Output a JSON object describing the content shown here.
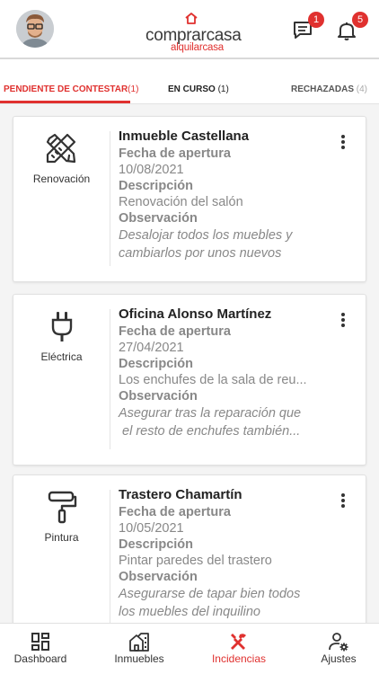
{
  "header": {
    "logo_main": "comprarcasa",
    "logo_sub": "alquilarcasa",
    "messages_count": "1",
    "notifications_count": "5"
  },
  "tabs": [
    {
      "label": "PENDIENTE DE CONTESTAR",
      "count": "(1)"
    },
    {
      "label": "EN CURSO",
      "count": "(1)"
    },
    {
      "label": "RECHAZADAS",
      "count": "(4)"
    }
  ],
  "labels": {
    "fecha": "Fecha de apertura",
    "descripcion": "Descripción",
    "observacion": "Observación"
  },
  "cards": [
    {
      "category": "Renovación",
      "icon": "renovation-icon",
      "title": "Inmueble Castellana",
      "fecha": "10/08/2021",
      "descripcion": "Renovación del salón",
      "obs_line1": "Desalojar todos los muebles y",
      "obs_line2": "cambiarlos por unos nuevos"
    },
    {
      "category": "Eléctrica",
      "icon": "plug-icon",
      "title": "Oficina Alonso Martínez",
      "fecha": "27/04/2021",
      "descripcion": "Los enchufes de la sala de reu...",
      "obs_line1": "Asegurar tras la reparación que",
      "obs_line2": " el resto de enchufes también..."
    },
    {
      "category": "Pintura",
      "icon": "paint-roller-icon",
      "title": "Trastero Chamartín",
      "fecha": "10/05/2021",
      "descripcion": "Pintar paredes del trastero",
      "obs_line1": "Asegurarse de tapar bien todos",
      "obs_line2": "los muebles del inquilino"
    }
  ],
  "bottom_nav": [
    {
      "label": "Dashboard",
      "icon": "dashboard-icon"
    },
    {
      "label": "Inmuebles",
      "icon": "buildings-icon"
    },
    {
      "label": "Incidencias",
      "icon": "tools-icon"
    },
    {
      "label": "Ajustes",
      "icon": "user-settings-icon"
    }
  ],
  "colors": {
    "accent": "#e0312f",
    "text": "#222222",
    "muted": "#888888"
  }
}
